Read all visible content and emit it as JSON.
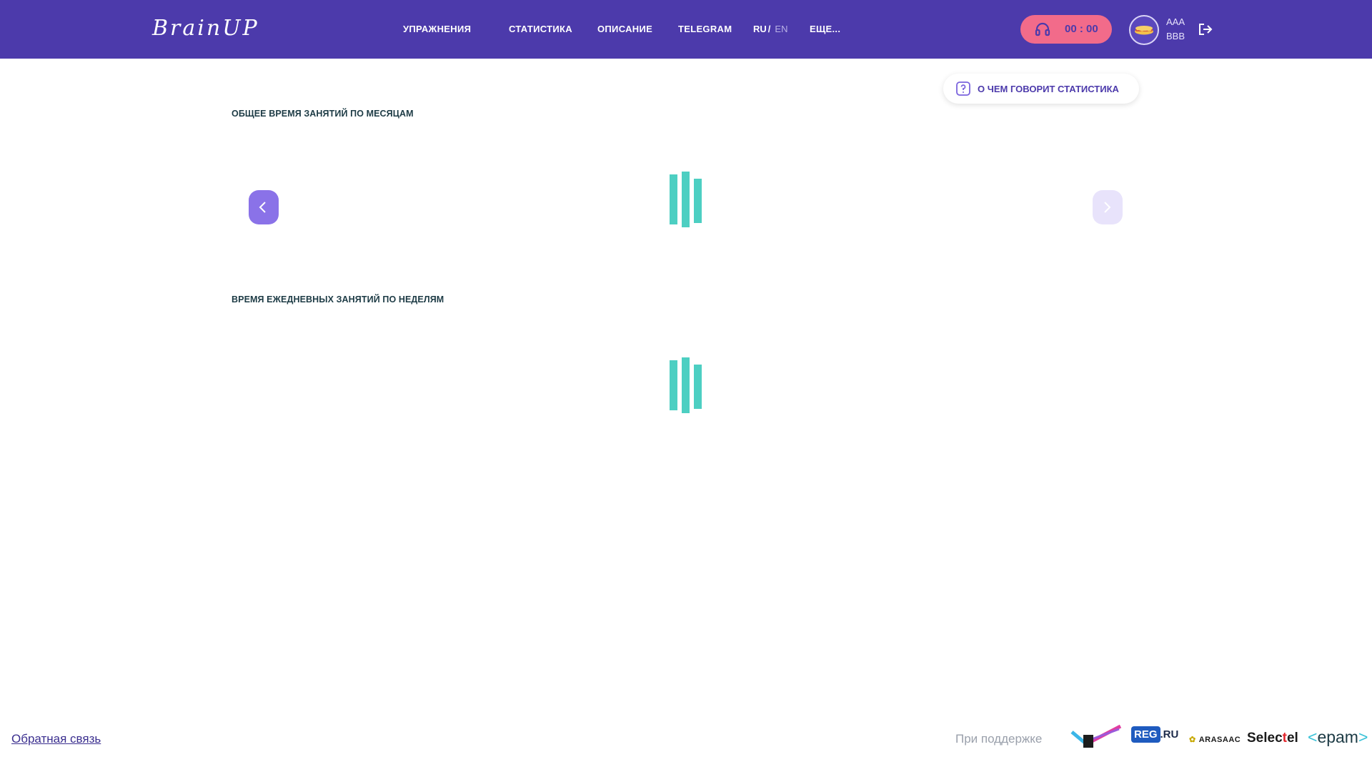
{
  "header": {
    "logo": "BrainUP",
    "nav": {
      "exercises": "УПРАЖНЕНИЯ",
      "statistics": "СТАТИСТИКА",
      "description": "ОПИСАНИЕ",
      "telegram": "TELEGRAM",
      "more": "ЕЩЕ..."
    },
    "lang": {
      "ru": "RU",
      "separator": "/",
      "en": "EN"
    },
    "timer": {
      "icon": "headphones-icon",
      "value": "00 : 00"
    },
    "user": {
      "avatar": "hotdog-avatar",
      "line1": "AAA",
      "line2": "BBB"
    },
    "logout_icon": "logout-icon"
  },
  "main": {
    "info_button": {
      "label": "О ЧЕМ ГОВОРИТ СТАТИСТИКА",
      "icon": "question-icon"
    },
    "monthly": {
      "title": "ОБЩЕЕ ВРЕМЯ ЗАНЯТИЙ ПО МЕСЯЦАМ"
    },
    "weekly": {
      "title": "ВРЕМЯ ЕЖЕДНЕВНЫХ ЗАНЯТИЙ ПО НЕДЕЛЯМ"
    }
  },
  "footer": {
    "feedback": "Обратная связь",
    "support": "При поддержке",
    "partners": {
      "reg_box": "REG",
      "reg_ru": ".RU",
      "arasaac": "ARASAAC",
      "selectel_a": "Selec",
      "selectel_t": "t",
      "selectel_b": "el",
      "epam_left": "<",
      "epam": "epam",
      "epam_right": ">"
    }
  },
  "colors": {
    "header_bg": "#4c3aab",
    "timer_bg": "#f26b8a",
    "loader": "#4dcfc2",
    "arrow_active": "#8a72e8",
    "arrow_disabled": "#e8e3fb"
  }
}
